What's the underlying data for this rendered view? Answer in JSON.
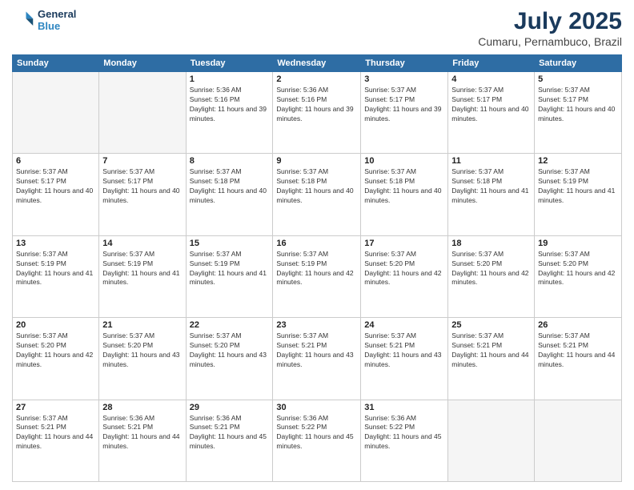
{
  "header": {
    "logo_line1": "General",
    "logo_line2": "Blue",
    "month": "July 2025",
    "location": "Cumaru, Pernambuco, Brazil"
  },
  "weekdays": [
    "Sunday",
    "Monday",
    "Tuesday",
    "Wednesday",
    "Thursday",
    "Friday",
    "Saturday"
  ],
  "weeks": [
    [
      {
        "day": "",
        "info": ""
      },
      {
        "day": "",
        "info": ""
      },
      {
        "day": "1",
        "info": "Sunrise: 5:36 AM\nSunset: 5:16 PM\nDaylight: 11 hours and 39 minutes."
      },
      {
        "day": "2",
        "info": "Sunrise: 5:36 AM\nSunset: 5:16 PM\nDaylight: 11 hours and 39 minutes."
      },
      {
        "day": "3",
        "info": "Sunrise: 5:37 AM\nSunset: 5:17 PM\nDaylight: 11 hours and 39 minutes."
      },
      {
        "day": "4",
        "info": "Sunrise: 5:37 AM\nSunset: 5:17 PM\nDaylight: 11 hours and 40 minutes."
      },
      {
        "day": "5",
        "info": "Sunrise: 5:37 AM\nSunset: 5:17 PM\nDaylight: 11 hours and 40 minutes."
      }
    ],
    [
      {
        "day": "6",
        "info": "Sunrise: 5:37 AM\nSunset: 5:17 PM\nDaylight: 11 hours and 40 minutes."
      },
      {
        "day": "7",
        "info": "Sunrise: 5:37 AM\nSunset: 5:17 PM\nDaylight: 11 hours and 40 minutes."
      },
      {
        "day": "8",
        "info": "Sunrise: 5:37 AM\nSunset: 5:18 PM\nDaylight: 11 hours and 40 minutes."
      },
      {
        "day": "9",
        "info": "Sunrise: 5:37 AM\nSunset: 5:18 PM\nDaylight: 11 hours and 40 minutes."
      },
      {
        "day": "10",
        "info": "Sunrise: 5:37 AM\nSunset: 5:18 PM\nDaylight: 11 hours and 40 minutes."
      },
      {
        "day": "11",
        "info": "Sunrise: 5:37 AM\nSunset: 5:18 PM\nDaylight: 11 hours and 41 minutes."
      },
      {
        "day": "12",
        "info": "Sunrise: 5:37 AM\nSunset: 5:19 PM\nDaylight: 11 hours and 41 minutes."
      }
    ],
    [
      {
        "day": "13",
        "info": "Sunrise: 5:37 AM\nSunset: 5:19 PM\nDaylight: 11 hours and 41 minutes."
      },
      {
        "day": "14",
        "info": "Sunrise: 5:37 AM\nSunset: 5:19 PM\nDaylight: 11 hours and 41 minutes."
      },
      {
        "day": "15",
        "info": "Sunrise: 5:37 AM\nSunset: 5:19 PM\nDaylight: 11 hours and 41 minutes."
      },
      {
        "day": "16",
        "info": "Sunrise: 5:37 AM\nSunset: 5:19 PM\nDaylight: 11 hours and 42 minutes."
      },
      {
        "day": "17",
        "info": "Sunrise: 5:37 AM\nSunset: 5:20 PM\nDaylight: 11 hours and 42 minutes."
      },
      {
        "day": "18",
        "info": "Sunrise: 5:37 AM\nSunset: 5:20 PM\nDaylight: 11 hours and 42 minutes."
      },
      {
        "day": "19",
        "info": "Sunrise: 5:37 AM\nSunset: 5:20 PM\nDaylight: 11 hours and 42 minutes."
      }
    ],
    [
      {
        "day": "20",
        "info": "Sunrise: 5:37 AM\nSunset: 5:20 PM\nDaylight: 11 hours and 42 minutes."
      },
      {
        "day": "21",
        "info": "Sunrise: 5:37 AM\nSunset: 5:20 PM\nDaylight: 11 hours and 43 minutes."
      },
      {
        "day": "22",
        "info": "Sunrise: 5:37 AM\nSunset: 5:20 PM\nDaylight: 11 hours and 43 minutes."
      },
      {
        "day": "23",
        "info": "Sunrise: 5:37 AM\nSunset: 5:21 PM\nDaylight: 11 hours and 43 minutes."
      },
      {
        "day": "24",
        "info": "Sunrise: 5:37 AM\nSunset: 5:21 PM\nDaylight: 11 hours and 43 minutes."
      },
      {
        "day": "25",
        "info": "Sunrise: 5:37 AM\nSunset: 5:21 PM\nDaylight: 11 hours and 44 minutes."
      },
      {
        "day": "26",
        "info": "Sunrise: 5:37 AM\nSunset: 5:21 PM\nDaylight: 11 hours and 44 minutes."
      }
    ],
    [
      {
        "day": "27",
        "info": "Sunrise: 5:37 AM\nSunset: 5:21 PM\nDaylight: 11 hours and 44 minutes."
      },
      {
        "day": "28",
        "info": "Sunrise: 5:36 AM\nSunset: 5:21 PM\nDaylight: 11 hours and 44 minutes."
      },
      {
        "day": "29",
        "info": "Sunrise: 5:36 AM\nSunset: 5:21 PM\nDaylight: 11 hours and 45 minutes."
      },
      {
        "day": "30",
        "info": "Sunrise: 5:36 AM\nSunset: 5:22 PM\nDaylight: 11 hours and 45 minutes."
      },
      {
        "day": "31",
        "info": "Sunrise: 5:36 AM\nSunset: 5:22 PM\nDaylight: 11 hours and 45 minutes."
      },
      {
        "day": "",
        "info": ""
      },
      {
        "day": "",
        "info": ""
      }
    ]
  ]
}
